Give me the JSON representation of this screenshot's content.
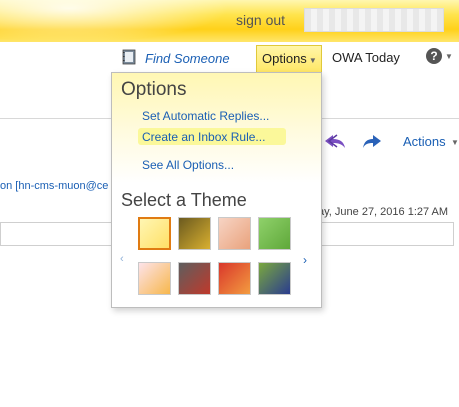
{
  "header": {
    "sign_out": "sign out",
    "colors": {
      "banner": "#ffd11a",
      "link": "#1a5fb4"
    }
  },
  "nav": {
    "find_someone": "Find Someone",
    "find_icon": "address-book-icon",
    "options": "Options",
    "owa_today": "OWA Today",
    "help_icon": "help-icon",
    "help_glyph": "?"
  },
  "message": {
    "sender": "on [hn-cms-muon@ce",
    "date": "ay, June 27, 2016 1:27 AM",
    "actions": "Actions"
  },
  "options_menu": {
    "title": "Options",
    "items": [
      {
        "label": "Set Automatic Replies..."
      },
      {
        "label": "Create an Inbox Rule..."
      },
      {
        "label": "See All Options..."
      }
    ],
    "theme_title": "Select a Theme",
    "themes": [
      {
        "name": "theme-yellow",
        "colors": [
          "#fff6b3",
          "#ffe066"
        ],
        "selected": true
      },
      {
        "name": "theme-gold-stripes",
        "colors": [
          "#6b5a1f",
          "#d9b030"
        ]
      },
      {
        "name": "theme-pink-floral",
        "colors": [
          "#f7d4c4",
          "#e9a27c"
        ]
      },
      {
        "name": "theme-green-leaves",
        "colors": [
          "#8fd16a",
          "#5fa83a"
        ]
      },
      {
        "name": "theme-pink-sunburst",
        "colors": [
          "#fde3ea",
          "#f7b74c"
        ]
      },
      {
        "name": "theme-robot",
        "colors": [
          "#5e5e5e",
          "#c0392b"
        ]
      },
      {
        "name": "theme-red-abstract",
        "colors": [
          "#d9372b",
          "#f39c40"
        ]
      },
      {
        "name": "theme-blue-monster",
        "colors": [
          "#7aa83e",
          "#2a3c8f"
        ]
      }
    ]
  }
}
